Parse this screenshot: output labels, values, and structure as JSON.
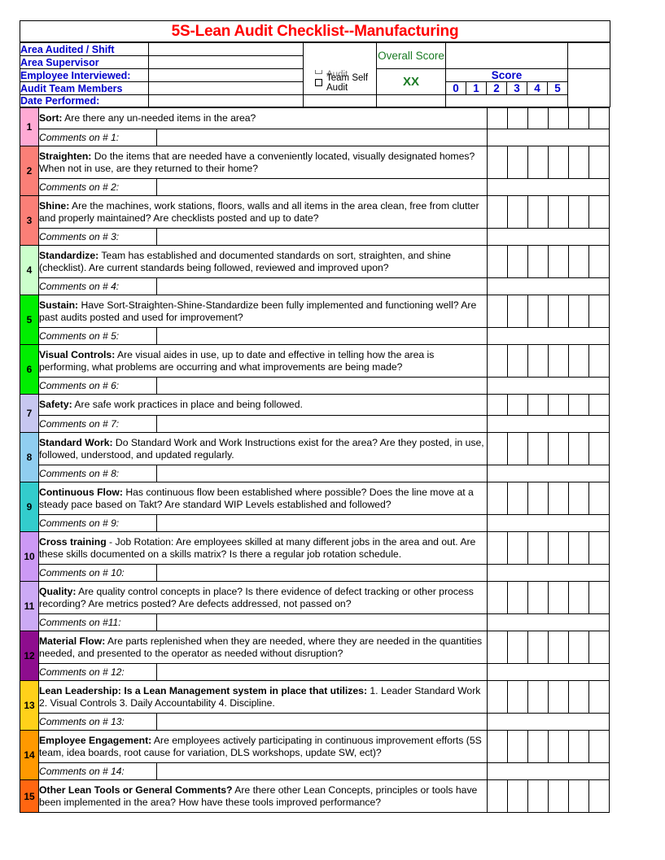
{
  "title": "5S-Lean Audit Checklist--Manufacturing",
  "header": {
    "fields": [
      {
        "label": "Area Audited / Shift",
        "value": ""
      },
      {
        "label": "Area Supervisor",
        "value": ""
      },
      {
        "label": "Employee Interviewed:",
        "value": ""
      },
      {
        "label": "Audit Team Members",
        "value": ""
      },
      {
        "label": "Date Performed:",
        "value": ""
      }
    ],
    "audit_type": {
      "clipped_option": "Conducted Audit",
      "self_audit_option": "Team Self Audit",
      "self_audit_checked": false,
      "clipped_checked": false
    },
    "overall_score": {
      "label": "Overall Score",
      "value": "XX",
      "color": "#1a7a24"
    },
    "score_header": {
      "title": "Score",
      "columns": [
        "0",
        "1",
        "2",
        "3",
        "4",
        "5"
      ],
      "color": "#0000CC"
    },
    "label_color": "#0000CC",
    "title_color": "#FF0000"
  },
  "rows": [
    {
      "num": "1",
      "color": "#FFAAD4",
      "bold": "Sort:",
      "text": " Are there any un-needed items in the area?",
      "comment_label": "Comments on # 1:",
      "comment_value": "",
      "scores": [
        "",
        "",
        "",
        "",
        "",
        ""
      ],
      "q_height": 26
    },
    {
      "num": "2",
      "color": "#FB7F77",
      "bold": "Straighten:",
      "text": "  Do the items that are needed have a conveniently located, visually designated homes?  When not in use, are they returned to their home?",
      "comment_label": "Comments on # 2:",
      "comment_value": "",
      "scores": [
        "",
        "",
        "",
        "",
        "",
        ""
      ],
      "q_height": 40
    },
    {
      "num": "3",
      "color": "#FB7F77",
      "bold": "Shine:",
      "text": "  Are the machines, work stations, floors, walls and all items in the area clean, free from clutter and properly maintained?  Are checklists posted and up to date?",
      "comment_label": "Comments on # 3:",
      "comment_value": "",
      "scores": [
        "",
        "",
        "",
        "",
        "",
        ""
      ],
      "q_height": 40
    },
    {
      "num": "4",
      "color": "#CCFFCC",
      "bold": "Standardize:",
      "text": "  Team has established and documented standards on sort, straighten, and shine (checklist).  Are current standards being followed, reviewed and improved upon?",
      "comment_label": "Comments on # 4:",
      "comment_value": "",
      "scores": [
        "",
        "",
        "",
        "",
        "",
        ""
      ],
      "q_height": 40
    },
    {
      "num": "5",
      "color": "#00EE00",
      "bold": "Sustain:",
      "text": "  Have Sort-Straighten-Shine-Standardize been fully implemented and functioning well? Are past audits posted and used for improvement?",
      "comment_label": "Comments on # 5:",
      "comment_value": "",
      "scores": [
        "",
        "",
        "",
        "",
        "",
        ""
      ],
      "q_height": 40
    },
    {
      "num": "6",
      "color": "#00EE00",
      "bold": "Visual Controls:",
      "text": " Are visual aides in use, up to date and effective in telling how the area is performing, what problems are occurring and what improvements are being made?",
      "comment_label": "Comments on # 6:",
      "comment_value": "",
      "scores": [
        "",
        "",
        "",
        "",
        "",
        ""
      ],
      "q_height": 40
    },
    {
      "num": "7",
      "color": "#C7C7F0",
      "bold": "Safety:",
      "text": "  Are safe work practices in place and being followed.",
      "comment_label": "Comments on # 7:",
      "comment_value": "",
      "scores": [
        "",
        "",
        "",
        "",
        "",
        ""
      ],
      "q_height": 26
    },
    {
      "num": "8",
      "color": "#90CEF0",
      "bold": "Standard Work:",
      "text": " Do Standard Work and Work Instructions exist for the area?  Are they posted, in use, followed, understood, and updated regularly.",
      "comment_label": "Comments on # 8:",
      "comment_value": "",
      "scores": [
        "",
        "",
        "",
        "",
        "",
        ""
      ],
      "q_height": 40
    },
    {
      "num": "9",
      "color": "#33CCCC",
      "bold": "Continuous Flow:",
      "text": " Has continuous flow been established where possible? Does the line move at a steady pace based on Takt?  Are standard WIP Levels established and followed?",
      "comment_label": "Comments on # 9:",
      "comment_value": "",
      "scores": [
        "",
        "",
        "",
        "",
        "",
        ""
      ],
      "q_height": 40
    },
    {
      "num": "10",
      "color": "#CC99F5",
      "bold": "Cross training",
      "text": " - Job Rotation: Are employees skilled at many different jobs in the area and out.  Are these skills documented on a skills matrix?  Is there a regular job rotation schedule.",
      "comment_label": "Comments on # 10:",
      "comment_value": "",
      "scores": [
        "",
        "",
        "",
        "",
        "",
        ""
      ],
      "q_height": 40
    },
    {
      "num": "11",
      "color": "#CCAAF5",
      "bold": "Quality:",
      "text": " Are quality control concepts in place? Is there evidence of defect tracking or other process recording? Are metrics posted? Are defects addressed, not passed on?",
      "comment_label": "Comments on #11:",
      "comment_value": "",
      "scores": [
        "",
        "",
        "",
        "",
        "",
        ""
      ],
      "q_height": 40
    },
    {
      "num": "12",
      "color": "#8E0D8E",
      "bold": "Material Flow:",
      "text": "  Are parts replenished when they are needed, where they are needed in the quantities needed, and presented to the  operator as needed without disruption?",
      "comment_label": "Comments on # 12:",
      "comment_value": "",
      "scores": [
        "",
        "",
        "",
        "",
        "",
        ""
      ],
      "q_height": 40
    },
    {
      "num": "13",
      "color": "#FFD11A",
      "bold": "Lean Leadership: Is a Lean Management system in place that utilizes:",
      "text": " 1. Leader Standard Work  2. Visual Controls 3. Daily Accountability 4. Discipline.",
      "comment_label": "Comments on # 13:",
      "comment_value": "",
      "scores": [
        "",
        "",
        "",
        "",
        "",
        ""
      ],
      "q_height": 40
    },
    {
      "num": "14",
      "color": "#FF9900",
      "bold": "Employee Engagement:",
      "text": "  Are employees actively participating in continuous improvement efforts (5S team, idea boards, root cause for variation, DLS workshops, update SW, ect)?",
      "comment_label": "Comments on # 14:",
      "comment_value": "",
      "scores": [
        "",
        "",
        "",
        "",
        "",
        ""
      ],
      "q_height": 40
    },
    {
      "num": "15",
      "color": "#FF6611",
      "bold": "Other Lean Tools or General Comments?",
      "text": " Are there other Lean Concepts, principles or tools have been implemented in the area? How have these tools improved performance?",
      "comment_label": "",
      "comment_value": "",
      "scores": [
        "",
        "",
        "",
        "",
        "",
        ""
      ],
      "q_height": 40,
      "no_comment_row": true
    }
  ]
}
